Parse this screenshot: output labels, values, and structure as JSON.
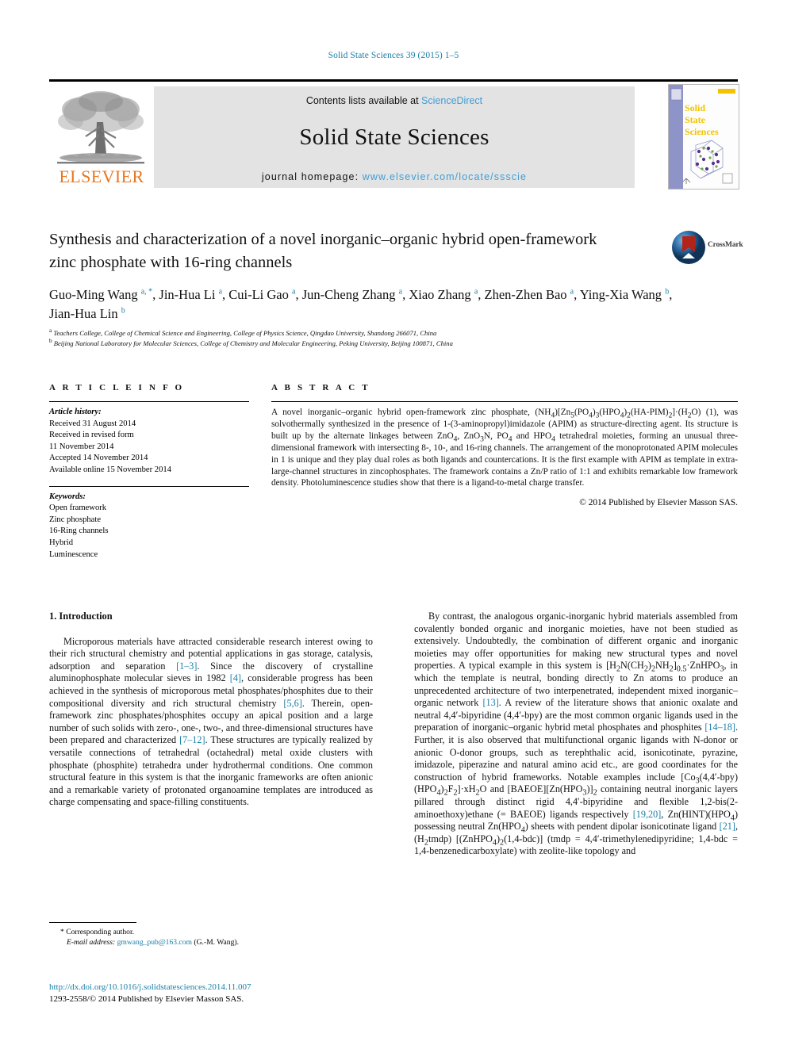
{
  "running_head": "Solid State Sciences 39 (2015) 1–5",
  "masthead": {
    "contents_prefix": "Contents lists available at ",
    "sciencedirect": "ScienceDirect",
    "journal_name": "Solid State Sciences",
    "homepage_prefix": "journal homepage: ",
    "homepage_url": "www.elsevier.com/locate/ssscie",
    "publisher_wordmark": "ELSEVIER",
    "cover_title_line1": "Solid",
    "cover_title_line2": "State",
    "cover_title_line3": "Sciences",
    "link_color": "#3f9ed4",
    "banner_bg": "#e3e3e3",
    "elsevier_orange": "#E87722"
  },
  "article": {
    "title": "Synthesis and characterization of a novel inorganic–organic hybrid open-framework zinc phosphate with 16-ring channels",
    "crossmark_label": "CrossMark",
    "authors_line1": "Guo-Ming Wang",
    "authors_html": "Guo-Ming Wang <sup>a, *</sup>, Jin-Hua Li <sup>a</sup>, Cui-Li Gao <sup>a</sup>, Jun-Cheng Zhang <sup>a</sup>, Xiao Zhang <sup>a</sup>, Zhen-Zhen Bao <sup>a</sup>, Ying-Xia Wang <sup>b</sup>, Jian-Hua Lin <sup>b</sup>",
    "affiliation_a": "Teachers College, College of Chemical Science and Engineering, College of Physics Science, Qingdao University, Shandong 266071, China",
    "affiliation_b": "Beijing National Laboratory for Molecular Sciences, College of Chemistry and Molecular Engineering, Peking University, Beijing 100871, China"
  },
  "article_info": {
    "heading": "A R T I C L E  I N F O",
    "history_label": "Article history:",
    "history": [
      "Received 31 August 2014",
      "Received in revised form",
      "11 November 2014",
      "Accepted 14 November 2014",
      "Available online 15 November 2014"
    ],
    "keywords_label": "Keywords:",
    "keywords": [
      "Open framework",
      "Zinc phosphate",
      "16-Ring channels",
      "Hybrid",
      "Luminescence"
    ]
  },
  "abstract": {
    "heading": "A B S T R A C T",
    "text_html": "A novel inorganic–organic hybrid open-framework zinc phosphate, (NH<sub>4</sub>)[Zn<sub>5</sub>(PO<sub>4</sub>)<sub>3</sub>(HPO<sub>4</sub>)<sub>2</sub>(HA-PIM)<sub>2</sub>]·(H<sub>2</sub>O) (1), was solvothermally synthesized in the presence of 1-(3-aminopropyl)imidazole (APIM) as structure-directing agent. Its structure is built up by the alternate linkages between ZnO<sub>4</sub>, ZnO<sub>3</sub>N, PO<sub>4</sub> and HPO<sub>4</sub> tetrahedral moieties, forming an unusual three-dimensional framework with intersecting 8-, 10-, and 16-ring channels. The arrangement of the monoprotonated APIM molecules in 1 is unique and they play dual roles as both ligands and countercations. It is the first example with APIM as template in extra-large-channel structures in zincophosphates. The framework contains a Zn/P ratio of 1:1 and exhibits remarkable low framework density. Photoluminescence studies show that there is a ligand-to-metal charge transfer.",
    "copyright": "© 2014 Published by Elsevier Masson SAS."
  },
  "body": {
    "section_heading": "1. Introduction",
    "left_paragraph_1_html": "Microporous materials have attracted considerable research interest owing to their rich structural chemistry and potential applications in gas storage, catalysis, adsorption and separation <span class=\"ref\">[1–3]</span>. Since the discovery of crystalline aluminophosphate molecular sieves in 1982 <span class=\"ref\">[4]</span>, considerable progress has been achieved in the synthesis of microporous metal phosphates/phosphites due to their compositional diversity and rich structural chemistry <span class=\"ref\">[5,6]</span>. Therein, open-framework zinc phosphates/phosphites occupy an apical position and a large number of such solids with zero-, one-, two-, and three-dimensional structures have been prepared and characterized <span class=\"ref\">[7–12]</span>. These structures are typically realized by versatile connections of tetrahedral (octahedral) metal oxide clusters with phosphate (phosphite) tetrahedra under hydrothermal conditions. One common structural feature in this system is that the inorganic frameworks are often anionic and a remarkable variety of protonated organoamine templates are introduced as charge compensating and space-filling constituents.",
    "right_paragraph_1_html": "By contrast, the analogous organic-inorganic hybrid materials assembled from covalently bonded organic and inorganic moieties, have not been studied as extensively. Undoubtedly, the combination of different organic and inorganic moieties may offer opportunities for making new structural types and novel properties. A typical example in this system is [H<sub>2</sub>N(CH<sub>2</sub>)<sub>2</sub>NH<sub>2</sub>]<sub>0.5</sub>·ZnHPO<sub>3</sub>, in which the template is neutral, bonding directly to Zn atoms to produce an unprecedented architecture of two interpenetrated, independent mixed inorganic–organic network <span class=\"ref\">[13]</span>. A review of the literature shows that anionic oxalate and neutral 4,4′-bipyridine (4,4′-bpy) are the most common organic ligands used in the preparation of inorganic–organic hybrid metal phosphates and phosphites <span class=\"ref\">[14–18]</span>. Further, it is also observed that multifunctional organic ligands with N-donor or anionic O-donor groups, such as terephthalic acid, isonicotinate, pyrazine, imidazole, piperazine and natural amino acid etc., are good coordinates for the construction of hybrid frameworks. Notable examples include [Co<sub>3</sub>(4,4′-bpy)(HPO<sub>4</sub>)<sub>2</sub>F<sub>2</sub>]·xH<sub>2</sub>O and [BAEOE][Zn(HPO<sub>3</sub>)]<sub>2</sub> containing neutral inorganic layers pillared through distinct rigid 4,4′-bipyridine and flexible 1,2-bis(2-aminoethoxy)ethane (= BAEOE) ligands respectively <span class=\"ref\">[19,20]</span>, Zn(HINT)(HPO<sub>4</sub>) possessing neutral Zn(HPO<sub>4</sub>) sheets with pendent dipolar isonicotinate ligand <span class=\"ref\">[21]</span>, (H<sub>2</sub>tmdp) [(ZnHPO<sub>4</sub>)<sub>2</sub>(1,4-bdc)] (tmdp = 4,4′-trimethylenedipyridine; 1,4-bdc = 1,4-benzenedicarboxylate) with zeolite-like topology and"
  },
  "footer": {
    "corresponding_marker": "*",
    "corresponding_label": "Corresponding author.",
    "email_label": "E-mail address:",
    "email": "gmwang_pub@163.com",
    "email_owner": "(G.-M. Wang).",
    "doi_url": "http://dx.doi.org/10.1016/j.solidstatesciences.2014.11.007",
    "issn_line": "1293-2558/© 2014 Published by Elsevier Masson SAS."
  }
}
